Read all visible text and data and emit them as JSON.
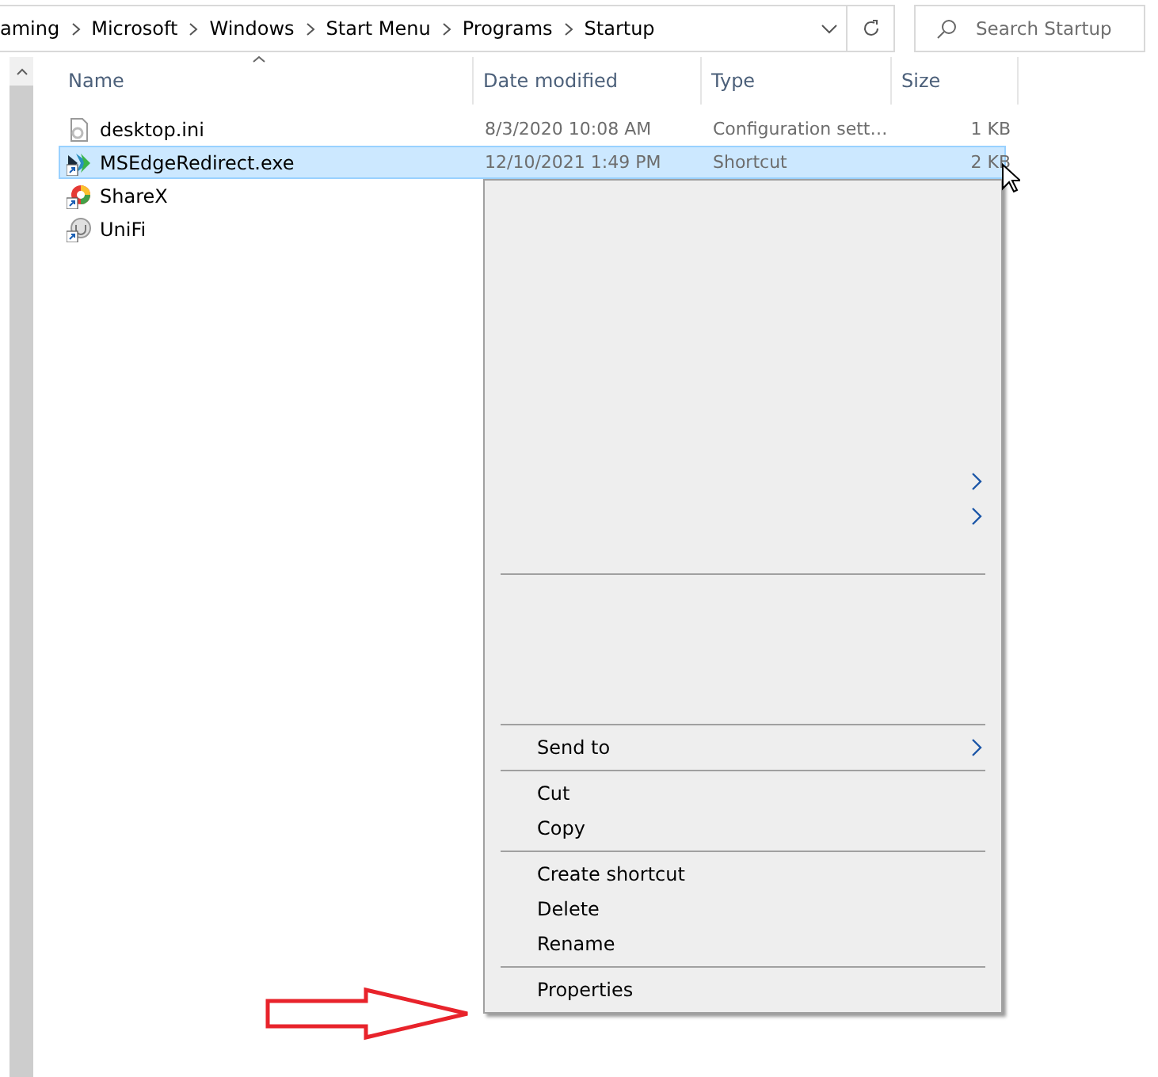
{
  "address_bar": {
    "crumbs": [
      "aming",
      "Microsoft",
      "Windows",
      "Start Menu",
      "Programs",
      "Startup"
    ]
  },
  "search": {
    "placeholder": "Search Startup"
  },
  "columns": [
    "Name",
    "Date modified",
    "Type",
    "Size"
  ],
  "files": [
    {
      "name": "desktop.ini",
      "date": "8/3/2020 10:08 AM",
      "type": "Configuration sett…",
      "size": "1 KB",
      "selected": false
    },
    {
      "name": "MSEdgeRedirect.exe",
      "date": "12/10/2021 1:49 PM",
      "type": "Shortcut",
      "size": "2 KB",
      "selected": true
    },
    {
      "name": "ShareX",
      "selected": false
    },
    {
      "name": "UniFi",
      "selected": false
    }
  ],
  "context_menu": [
    {
      "kind": "blank"
    },
    {
      "kind": "blank"
    },
    {
      "kind": "blank"
    },
    {
      "kind": "blank"
    },
    {
      "kind": "blank"
    },
    {
      "kind": "blank"
    },
    {
      "kind": "blank"
    },
    {
      "kind": "blank"
    },
    {
      "kind": "arrow"
    },
    {
      "kind": "arrow"
    },
    {
      "kind": "blank"
    },
    {
      "kind": "separator"
    },
    {
      "kind": "blank"
    },
    {
      "kind": "blank"
    },
    {
      "kind": "blank"
    },
    {
      "kind": "blank"
    },
    {
      "kind": "separator"
    },
    {
      "kind": "item",
      "label": "Send to",
      "submenu": true
    },
    {
      "kind": "separator"
    },
    {
      "kind": "item",
      "label": "Cut",
      "submenu": false
    },
    {
      "kind": "item",
      "label": "Copy",
      "submenu": false
    },
    {
      "kind": "separator"
    },
    {
      "kind": "item",
      "label": "Create shortcut",
      "submenu": false
    },
    {
      "kind": "item",
      "label": "Delete",
      "submenu": false
    },
    {
      "kind": "item",
      "label": "Rename",
      "submenu": false
    },
    {
      "kind": "separator"
    },
    {
      "kind": "item",
      "label": "Properties",
      "submenu": false
    }
  ]
}
